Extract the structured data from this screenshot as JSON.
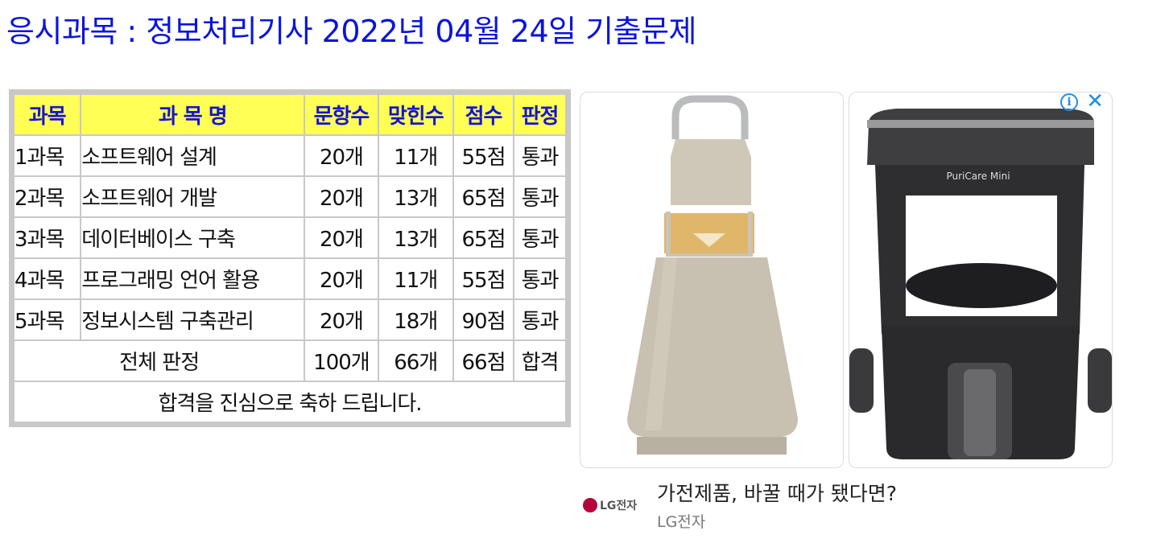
{
  "title": "응시과목 : 정보처리기사 2022년 04월 24일 기출문제",
  "table": {
    "headers": [
      "과목",
      "과 목 명",
      "문항수",
      "맞힌수",
      "점수",
      "판정"
    ],
    "rows": [
      [
        "1과목",
        "소프트웨어 설계",
        "20개",
        "11개",
        "55점",
        "통과"
      ],
      [
        "2과목",
        "소프트웨어 개발",
        "20개",
        "13개",
        "65점",
        "통과"
      ],
      [
        "3과목",
        "데이터베이스 구축",
        "20개",
        "13개",
        "65점",
        "통과"
      ],
      [
        "4과목",
        "프로그래밍 언어 활용",
        "20개",
        "11개",
        "55점",
        "통과"
      ],
      [
        "5과목",
        "정보시스템 구축관리",
        "20개",
        "18개",
        "90점",
        "통과"
      ]
    ],
    "total": {
      "label": "전체 판정",
      "questions": "100개",
      "correct": "66개",
      "score": "66점",
      "result": "합격"
    },
    "message": "합격을 진심으로 축하 드립니다."
  },
  "ad": {
    "product1_label": "",
    "product2_label": "PuriCare Mini",
    "info_icon": "info-icon",
    "close_icon": "close-icon",
    "headline": "가전제품, 바꿀 때가 됐다면?",
    "advertiser": "LG전자",
    "logo_text": "LG전자",
    "logo_color": "#b5003c"
  },
  "colors": {
    "title": "#0a14dc",
    "header_bg": "#ffff55",
    "header_text": "#1414d2",
    "fail_pass": "#e00000",
    "congrats_bg": "#99ff66"
  }
}
